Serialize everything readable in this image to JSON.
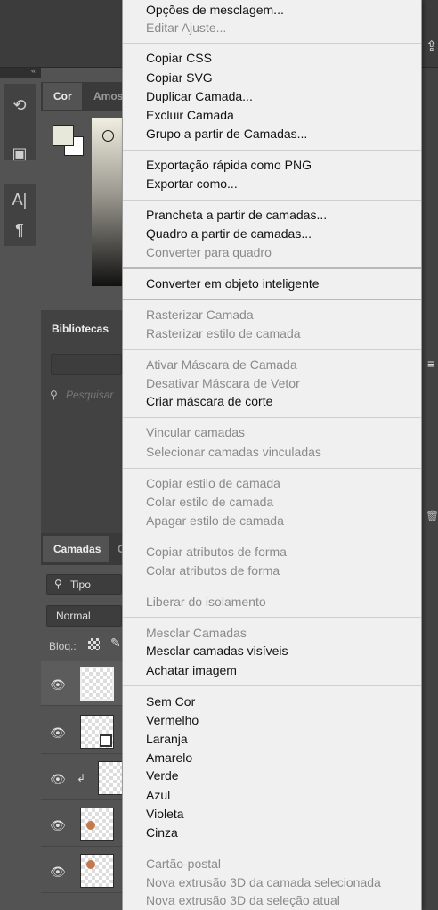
{
  "panels": {
    "color_tab": "Cor",
    "swatches_tab_partial": "Amos",
    "libraries_tab": "Bibliotecas",
    "libraries_search_placeholder": "Pesquisar",
    "layers_tab": "Camadas",
    "layers_tab2_partial": "C",
    "filter_kind": "Tipo",
    "blend_mode": "Normal",
    "lock_label": "Bloq.:"
  },
  "context_menu": {
    "items": [
      {
        "label": "Opções de mesclagem...",
        "enabled": true
      },
      {
        "label": "Editar Ajuste...",
        "enabled": false
      },
      {
        "label": "Copiar CSS",
        "enabled": true
      },
      {
        "label": "Copiar SVG",
        "enabled": true
      },
      {
        "label": "Duplicar Camada...",
        "enabled": true
      },
      {
        "label": "Excluir Camada",
        "enabled": true
      },
      {
        "label": "Grupo a partir de Camadas...",
        "enabled": true
      },
      {
        "label": "Exportação rápida como PNG",
        "enabled": true
      },
      {
        "label": "Exportar como...",
        "enabled": true
      },
      {
        "label": "Prancheta a partir de camadas...",
        "enabled": true
      },
      {
        "label": "Quadro a partir de camadas...",
        "enabled": true
      },
      {
        "label": "Converter para quadro",
        "enabled": false
      },
      {
        "label": "Converter em objeto inteligente",
        "enabled": true
      },
      {
        "label": "Rasterizar Camada",
        "enabled": false
      },
      {
        "label": "Rasterizar estilo de camada",
        "enabled": false
      },
      {
        "label": "Ativar Máscara de Camada",
        "enabled": false
      },
      {
        "label": "Desativar Máscara de Vetor",
        "enabled": false
      },
      {
        "label": "Criar máscara de corte",
        "enabled": true
      },
      {
        "label": "Vincular camadas",
        "enabled": false
      },
      {
        "label": "Selecionar camadas vinculadas",
        "enabled": false
      },
      {
        "label": "Copiar estilo de camada",
        "enabled": false
      },
      {
        "label": "Colar estilo de camada",
        "enabled": false
      },
      {
        "label": "Apagar estilo de camada",
        "enabled": false
      },
      {
        "label": "Copiar atributos de forma",
        "enabled": false
      },
      {
        "label": "Colar atributos de forma",
        "enabled": false
      },
      {
        "label": "Liberar do isolamento",
        "enabled": false
      },
      {
        "label": "Mesclar Camadas",
        "enabled": false
      },
      {
        "label": "Mesclar camadas visíveis",
        "enabled": true
      },
      {
        "label": "Achatar imagem",
        "enabled": true
      },
      {
        "label": "Sem Cor",
        "enabled": true
      },
      {
        "label": "Vermelho",
        "enabled": true
      },
      {
        "label": "Laranja",
        "enabled": true
      },
      {
        "label": "Amarelo",
        "enabled": true
      },
      {
        "label": "Verde",
        "enabled": true
      },
      {
        "label": "Azul",
        "enabled": true
      },
      {
        "label": "Violeta",
        "enabled": true
      },
      {
        "label": "Cinza",
        "enabled": true
      },
      {
        "label": "Cartão-postal",
        "enabled": false
      },
      {
        "label": "Nova extrusão 3D da camada selecionada",
        "enabled": false
      },
      {
        "label": "Nova extrusão 3D da seleção atual",
        "enabled": false
      }
    ]
  },
  "colors": {
    "menu_bg": "#f0f0f0",
    "menu_text": "#111111",
    "menu_disabled_text": "#8a8a8a",
    "ui_dark": "#424242",
    "ui_mid": "#535353",
    "layer_color_dot": "#c47a4e"
  }
}
